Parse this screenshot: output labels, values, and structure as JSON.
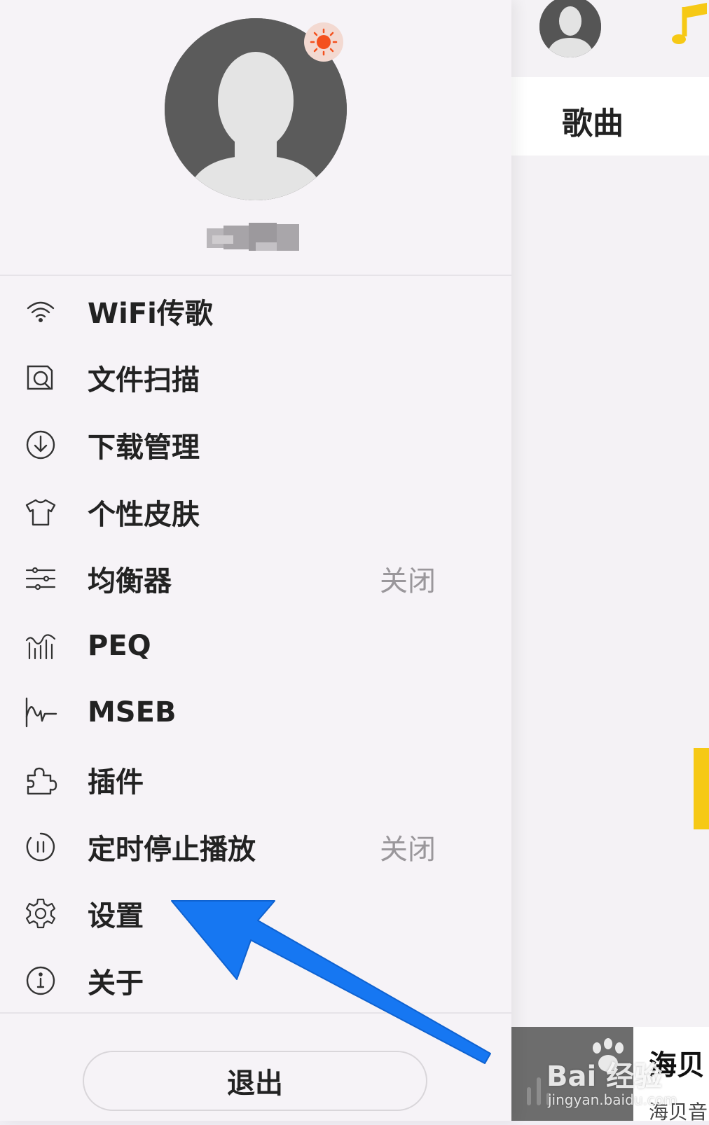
{
  "colors": {
    "drawer_bg": "#f6f3f7",
    "accent_yellow": "#f6c915",
    "arrow_blue": "#1677f2",
    "status_gray": "#9a979b",
    "badge_orange": "#f4511e"
  },
  "profile": {
    "avatar_icon": "default-avatar-icon",
    "badge_icon": "sun-icon"
  },
  "menu": {
    "items": [
      {
        "label": "WiFi传歌",
        "icon": "wifi-icon"
      },
      {
        "label": "文件扫描",
        "icon": "file-scan-icon"
      },
      {
        "label": "下载管理",
        "icon": "download-icon"
      },
      {
        "label": "个性皮肤",
        "icon": "tshirt-icon"
      },
      {
        "label": "均衡器",
        "icon": "sliders-icon",
        "status": "关闭"
      },
      {
        "label": "PEQ",
        "icon": "peq-bars-icon"
      },
      {
        "label": "MSEB",
        "icon": "waveform-icon"
      },
      {
        "label": "插件",
        "icon": "puzzle-icon"
      },
      {
        "label": "定时停止播放",
        "icon": "timer-pause-icon",
        "status": "关闭"
      },
      {
        "label": "设置",
        "icon": "gear-icon"
      },
      {
        "label": "关于",
        "icon": "info-icon"
      }
    ]
  },
  "logout": {
    "label": "退出"
  },
  "right_panel": {
    "tab_label": "歌曲",
    "player": {
      "title": "海贝",
      "subtitle": "海贝音"
    }
  },
  "watermark": {
    "text": "Bai 经验",
    "url": "jingyan.baidu.com"
  }
}
